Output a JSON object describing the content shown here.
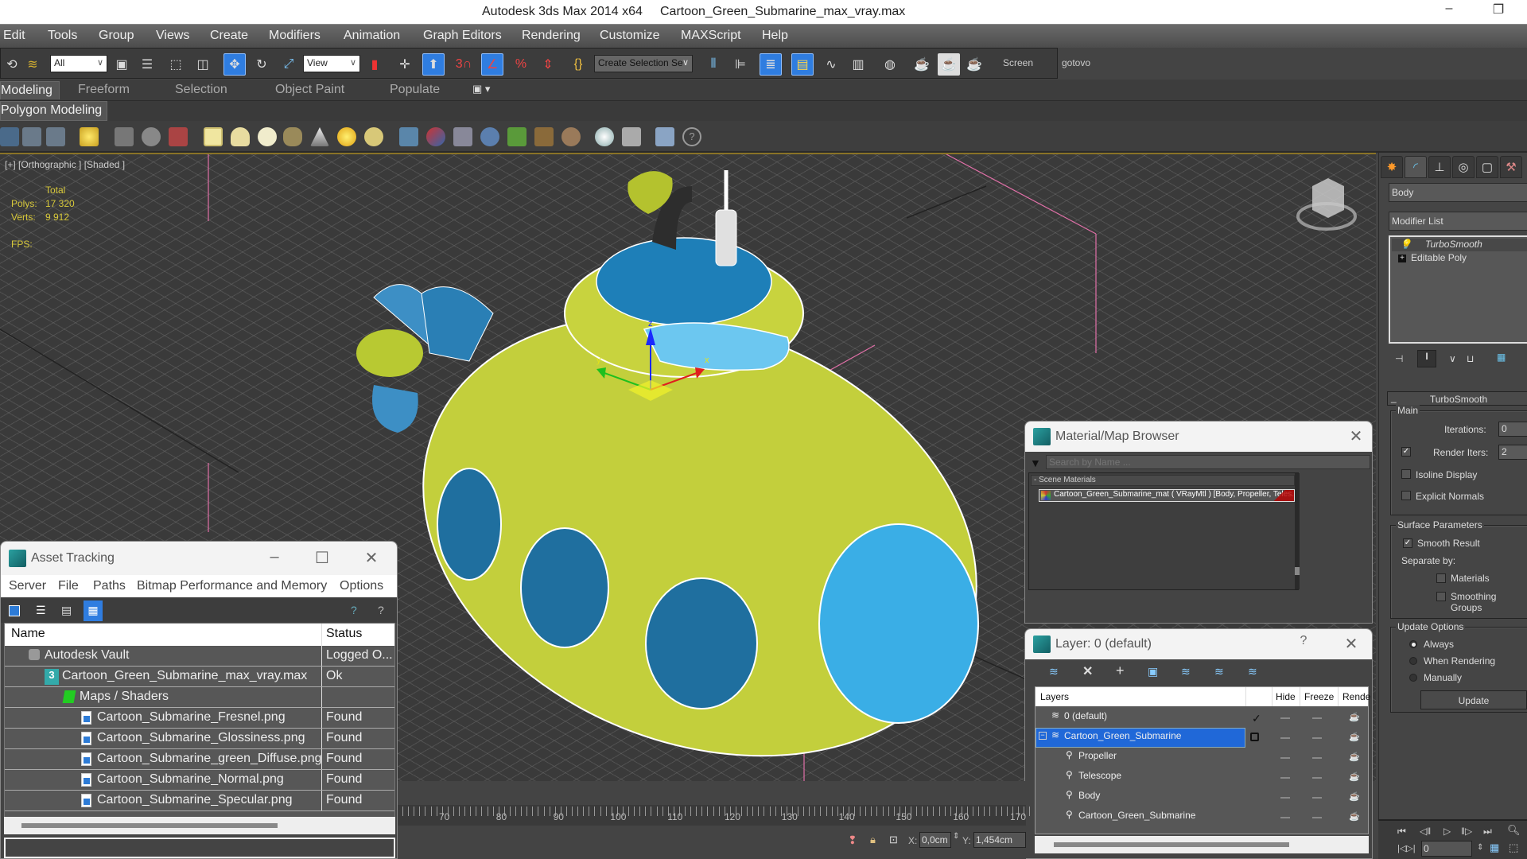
{
  "titlebar": {
    "app": "Autodesk 3ds Max  2014 x64",
    "file": "Cartoon_Green_Submarine_max_vray.max",
    "minimize_icon": "–",
    "restore_icon": "❐"
  },
  "menu": [
    "Edit",
    "Tools",
    "Group",
    "Views",
    "Create",
    "Modifiers",
    "Animation",
    "Graph Editors",
    "Rendering",
    "Customize",
    "MAXScript",
    "Help"
  ],
  "main_toolbar": {
    "selection_filter": "All",
    "reference_coord": "View",
    "named_selection": "Create Selection Se",
    "screen_label": "Screen",
    "gotovo_label": "gotovo"
  },
  "ribbon": {
    "tabs": [
      "Modeling",
      "Freeform",
      "Selection",
      "Object Paint",
      "Populate"
    ],
    "active": "Modeling",
    "subtab": "Polygon Modeling"
  },
  "viewport": {
    "label": "[+] [Orthographic ] [Shaded ]",
    "stats": {
      "total_label": "Total",
      "polys_label": "Polys:",
      "polys": "17 320",
      "verts_label": "Verts:",
      "verts": "9 912",
      "fps_label": "FPS:"
    },
    "axes": {
      "x": "x",
      "y": "y",
      "z": "z"
    }
  },
  "command_panel": {
    "object_name": "Body",
    "modifier_list": "Modifier List",
    "stack": [
      "TurboSmooth",
      "Editable Poly"
    ],
    "rollout_title": "TurboSmooth",
    "main": {
      "group": "Main",
      "iterations_label": "Iterations:",
      "iterations": "0",
      "render_iters_label": "Render Iters:",
      "render_iters": "2",
      "render_iters_checked": true,
      "isoline_label": "Isoline Display",
      "isoline_checked": false,
      "explicit_normals_label": "Explicit Normals",
      "explicit_normals_checked": false
    },
    "surface": {
      "group": "Surface Parameters",
      "smooth_result_label": "Smooth Result",
      "smooth_result_checked": true,
      "separate_by_label": "Separate by:",
      "materials_label": "Materials",
      "materials_checked": false,
      "smoothing_groups_label": "Smoothing Groups",
      "smoothing_groups_checked": false
    },
    "update": {
      "group": "Update Options",
      "options": [
        "Always",
        "When Rendering",
        "Manually"
      ],
      "selected": "Always",
      "button": "Update"
    }
  },
  "asset_tracking": {
    "title": "Asset Tracking",
    "menu": [
      "Server",
      "File",
      "Paths",
      "Bitmap Performance and Memory",
      "Options"
    ],
    "columns": [
      "Name",
      "Status"
    ],
    "rows": [
      {
        "name": "Autodesk Vault",
        "status": "Logged O...",
        "level": 1,
        "icon": "vault-icon"
      },
      {
        "name": "Cartoon_Green_Submarine_max_vray.max",
        "status": "Ok",
        "level": 2,
        "icon": "max-file-icon"
      },
      {
        "name": "Maps / Shaders",
        "status": "",
        "level": 3,
        "icon": "maps-icon"
      },
      {
        "name": "Cartoon_Submarine_Fresnel.png",
        "status": "Found",
        "level": 4,
        "icon": "image-file-icon"
      },
      {
        "name": "Cartoon_Submarine_Glossiness.png",
        "status": "Found",
        "level": 4,
        "icon": "image-file-icon"
      },
      {
        "name": "Cartoon_Submarine_green_Diffuse.png",
        "status": "Found",
        "level": 4,
        "icon": "image-file-icon"
      },
      {
        "name": "Cartoon_Submarine_Normal.png",
        "status": "Found",
        "level": 4,
        "icon": "image-file-icon"
      },
      {
        "name": "Cartoon_Submarine_Specular.png",
        "status": "Found",
        "level": 4,
        "icon": "image-file-icon"
      }
    ]
  },
  "material_browser": {
    "title": "Material/Map Browser",
    "search_placeholder": "Search by Name ...",
    "section": "- Scene Materials",
    "item": "Cartoon_Green_Submarine_mat  ( VRayMtl ) [Body, Propeller, Teles..."
  },
  "layer_manager": {
    "title": "Layer: 0 (default)",
    "help": "?",
    "columns": [
      "Layers",
      "Hide",
      "Freeze",
      "Rende"
    ],
    "rows": [
      {
        "name": "0 (default)",
        "type": "layer",
        "current": true
      },
      {
        "name": "Cartoon_Green_Submarine",
        "type": "layer",
        "selected": true
      },
      {
        "name": "Propeller",
        "type": "object"
      },
      {
        "name": "Telescope",
        "type": "object"
      },
      {
        "name": "Body",
        "type": "object"
      },
      {
        "name": "Cartoon_Green_Submarine",
        "type": "object"
      }
    ]
  },
  "timeline": {
    "labels": [
      "70",
      "80",
      "90",
      "100",
      "110",
      "120",
      "130",
      "140",
      "150",
      "160",
      "170"
    ],
    "x_label": "X:",
    "x_value": "0,0cm",
    "y_label": "Y:",
    "y_value": "1,454cm"
  },
  "animation": {
    "frame": "0"
  },
  "colors": {
    "accent": "#2f7de0",
    "viewport_border": "#8a7326",
    "stats": "#d8c93a",
    "sub_body": "#c3cf3c",
    "sub_blue": "#3da9e0"
  }
}
